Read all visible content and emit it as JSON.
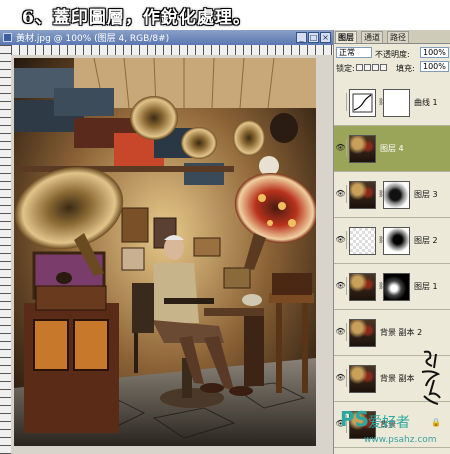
{
  "caption": {
    "text": "6、蓋印圖層，作銳化處理。"
  },
  "document": {
    "title": "黃材.jpg @ 100% (图层 4, RGB/8#)",
    "controls": [
      "_",
      "□",
      "×"
    ]
  },
  "panel": {
    "tabs": [
      "图层",
      "通道",
      "路径"
    ],
    "blend_mode": "正常",
    "opacity_label": "不透明度:",
    "opacity_value": "100%",
    "lock_label": "锁定:",
    "fill_label": "填充:",
    "fill_value": "100%",
    "layers": [
      {
        "name": "曲线 1",
        "visible": false,
        "selected": false,
        "thumb": "curves-icon",
        "mask": "white"
      },
      {
        "name": "图层 4",
        "visible": true,
        "selected": true,
        "thumb": "photo",
        "mask": null
      },
      {
        "name": "图层 3",
        "visible": true,
        "selected": false,
        "thumb": "photo",
        "mask": "bw"
      },
      {
        "name": "图层 2",
        "visible": true,
        "selected": false,
        "thumb": "checker",
        "mask": "bw2"
      },
      {
        "name": "图层 1",
        "visible": true,
        "selected": false,
        "thumb": "photo",
        "mask": "bw3"
      },
      {
        "name": "背景 副本 2",
        "visible": true,
        "selected": false,
        "thumb": "photo",
        "mask": null
      },
      {
        "name": "背景 副本",
        "visible": true,
        "selected": false,
        "thumb": "photo",
        "mask": null
      },
      {
        "name": "背景",
        "visible": true,
        "selected": false,
        "thumb": "photo",
        "mask": null,
        "locked": true
      }
    ]
  },
  "watermark": {
    "brand": "PS",
    "brand_cn": "爱好者",
    "url": "www.psahz.com",
    "signature": "黑桃猴"
  },
  "icons": {
    "eye": "eye-icon",
    "lock": "lock-icon",
    "chain": "link-icon"
  },
  "colors": {
    "selected_layer": "#9aa55a",
    "titlebar": "#5a77b0",
    "watermark": "#2aa8a0"
  }
}
